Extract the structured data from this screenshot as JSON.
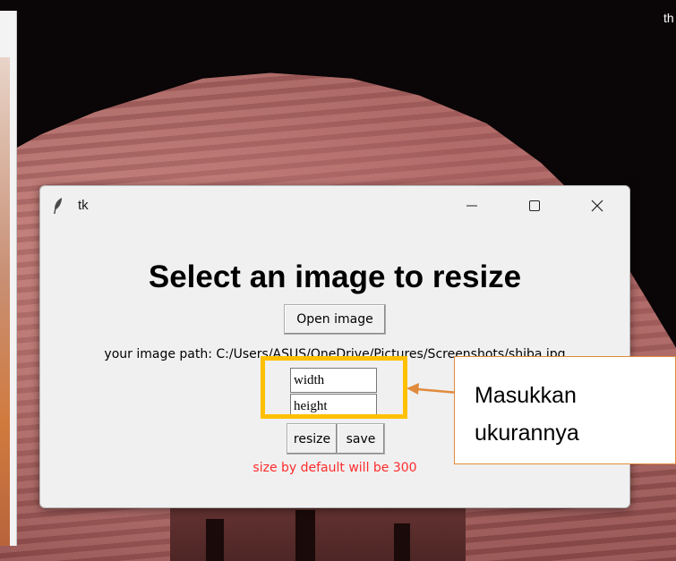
{
  "desktop": {
    "corner_text": "th"
  },
  "window": {
    "title": "tk",
    "controls": {
      "minimize": "—",
      "maximize": "☐",
      "close": "✕"
    }
  },
  "app": {
    "heading": "Select an image to resize",
    "open_button": "Open image",
    "path_label": "your image path: C:/Users/ASUS/OneDrive/Pictures/Screenshots/shiba.jpg",
    "width_entry": "width",
    "height_entry": "height",
    "resize_button": "resize",
    "save_button": "save",
    "default_note": "size by default will be 300"
  },
  "annotation": {
    "callout_line1": "Masukkan",
    "callout_line2": "ukurannya",
    "highlight_color": "#ffc000",
    "arrow_color": "#e08a3c"
  },
  "colors": {
    "note_red": "#ff2b2b",
    "window_bg": "#f0f0f0"
  }
}
